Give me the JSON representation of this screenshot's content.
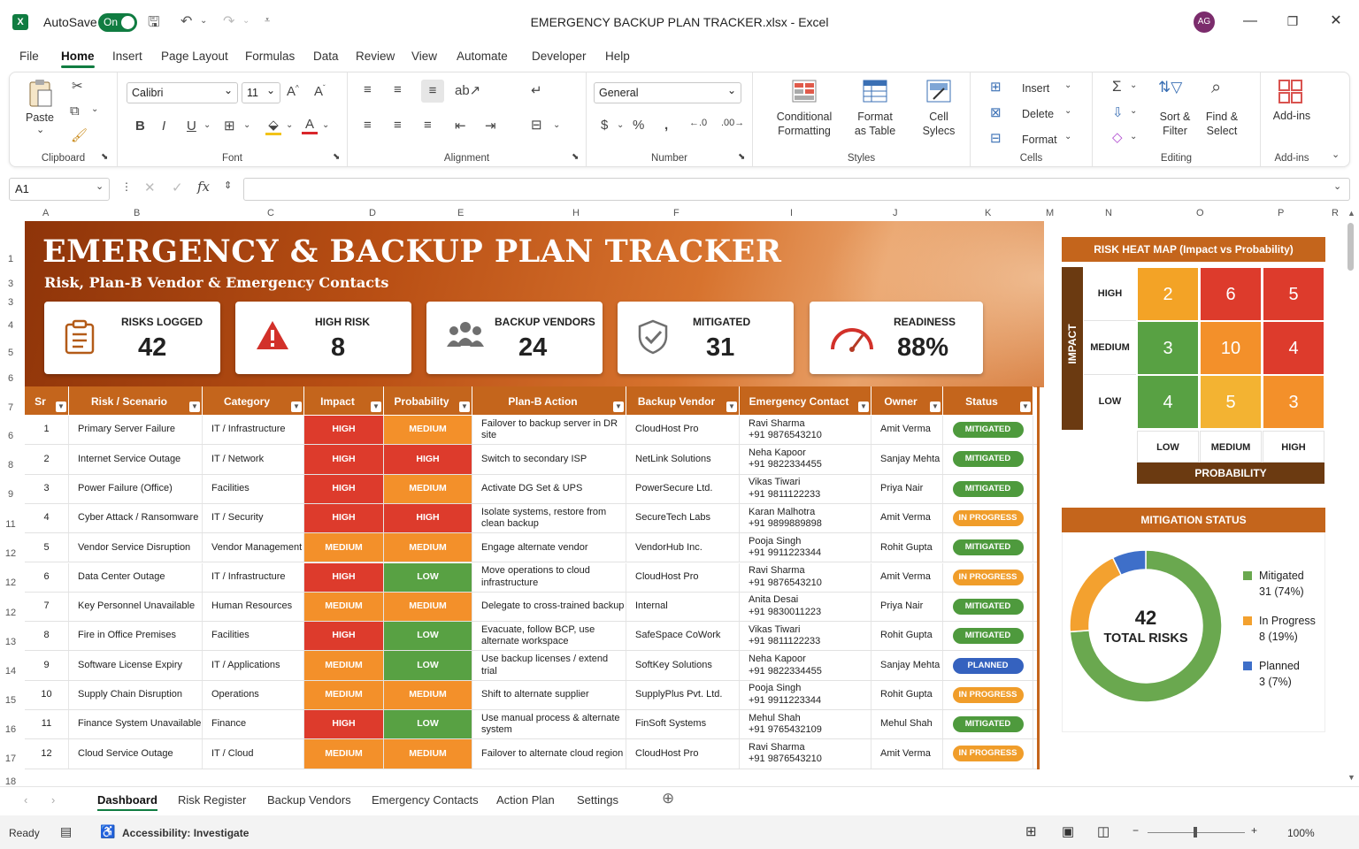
{
  "window": {
    "app_icon": "X",
    "autosave_label": "AutoSave",
    "autosave_state": "On",
    "doc_title": "EMERGENCY BACKUP PLAN TRACKER.xlsx  -  Excel",
    "avatar": "AG"
  },
  "menu": [
    "File",
    "Home",
    "Insert",
    "Page Layout",
    "Formulas",
    "Data",
    "Review",
    "View",
    "Automate",
    "Developer",
    "Help"
  ],
  "ribbon": {
    "clipboard": {
      "paste": "Paste",
      "label": "Clipboard"
    },
    "font": {
      "name": "Calibri",
      "size": "11",
      "label": "Font"
    },
    "alignment": {
      "label": "Alignment"
    },
    "number": {
      "format": "General",
      "label": "Number"
    },
    "styles": {
      "conditional": "Conditional Formatting",
      "format_table": "Format as Table",
      "cell_styles": "Cell Sylecs",
      "label": "Styles"
    },
    "cells": {
      "insert": "Insert",
      "delete": "Delete",
      "format": "Format",
      "label": "Cells"
    },
    "editing": {
      "sort": "Sort & Filter",
      "find": "Find & Select",
      "label": "Editing"
    },
    "addins": {
      "btn": "Add-ins",
      "label": "Add-ins"
    }
  },
  "formula_bar": {
    "name_box": "A1",
    "formula": ""
  },
  "columns": [
    "A",
    "B",
    "C",
    "D",
    "E",
    "H",
    "F",
    "I",
    "J",
    "K",
    "M",
    "N",
    "O",
    "P",
    "R"
  ],
  "rows": [
    "1",
    "3",
    "3",
    "4",
    "5",
    "6",
    "7",
    "6",
    "8",
    "9",
    "11",
    "12",
    "12",
    "12",
    "13",
    "14",
    "15",
    "16",
    "17",
    "18"
  ],
  "dashboard": {
    "title": "EMERGENCY & BACKUP PLAN TRACKER",
    "subtitle": "Risk, Plan-B Vendor & Emergency Contacts",
    "kpis": [
      {
        "label": "RISKS LOGGED",
        "value": "42",
        "icon": "clipboard-icon"
      },
      {
        "label": "HIGH RISK",
        "value": "8",
        "icon": "warning-icon"
      },
      {
        "label": "BACKUP VENDORS",
        "value": "24",
        "icon": "people-icon"
      },
      {
        "label": "MITIGATED",
        "value": "31",
        "icon": "shield-check-icon"
      },
      {
        "label": "READINESS",
        "value": "88%",
        "icon": "gauge-icon"
      }
    ]
  },
  "table": {
    "headers": [
      "Sr",
      "Risk / Scenario",
      "Category",
      "Impact",
      "Probability",
      "Plan-B Action",
      "Backup Vendor",
      "Emergency Contact",
      "Owner",
      "Status"
    ],
    "rows": [
      {
        "sr": "1",
        "risk": "Primary Server Failure",
        "category": "IT / Infrastructure",
        "impact": "HIGH",
        "probability": "MEDIUM",
        "action": "Failover to backup server in DR site",
        "vendor": "CloudHost Pro",
        "contact": "Ravi Sharma\n+91 9876543210",
        "owner": "Amit Verma",
        "status": "MITIGATED"
      },
      {
        "sr": "2",
        "risk": "Internet Service Outage",
        "category": "IT / Network",
        "impact": "HIGH",
        "probability": "HIGH",
        "action": "Switch to secondary ISP",
        "vendor": "NetLink Solutions",
        "contact": "Neha Kapoor\n+91 9822334455",
        "owner": "Sanjay Mehta",
        "status": "MITIGATED"
      },
      {
        "sr": "3",
        "risk": "Power Failure (Office)",
        "category": "Facilities",
        "impact": "HIGH",
        "probability": "MEDIUM",
        "action": "Activate DG Set & UPS",
        "vendor": "PowerSecure Ltd.",
        "contact": "Vikas Tiwari\n+91 9811122233",
        "owner": "Priya Nair",
        "status": "MITIGATED"
      },
      {
        "sr": "4",
        "risk": "Cyber Attack / Ransomware",
        "category": "IT / Security",
        "impact": "HIGH",
        "probability": "HIGH",
        "action": "Isolate systems, restore from clean backup",
        "vendor": "SecureTech Labs",
        "contact": "Karan Malhotra\n+91 9899889898",
        "owner": "Amit Verma",
        "status": "IN PROGRESS"
      },
      {
        "sr": "5",
        "risk": "Vendor Service Disruption",
        "category": "Vendor Management",
        "impact": "MEDIUM",
        "probability": "MEDIUM",
        "action": "Engage alternate vendor",
        "vendor": "VendorHub Inc.",
        "contact": "Pooja Singh\n+91 9911223344",
        "owner": "Rohit Gupta",
        "status": "MITIGATED"
      },
      {
        "sr": "6",
        "risk": "Data Center Outage",
        "category": "IT / Infrastructure",
        "impact": "HIGH",
        "probability": "LOW",
        "action": "Move operations to cloud infrastructure",
        "vendor": "CloudHost Pro",
        "contact": "Ravi Sharma\n+91 9876543210",
        "owner": "Amit Verma",
        "status": "IN PROGRESS"
      },
      {
        "sr": "7",
        "risk": "Key Personnel Unavailable",
        "category": "Human Resources",
        "impact": "MEDIUM",
        "probability": "MEDIUM",
        "action": "Delegate to cross-trained backup",
        "vendor": "Internal",
        "contact": "Anita Desai\n+91 9830011223",
        "owner": "Priya Nair",
        "status": "MITIGATED"
      },
      {
        "sr": "8",
        "risk": "Fire in Office Premises",
        "category": "Facilities",
        "impact": "HIGH",
        "probability": "LOW",
        "action": "Evacuate, follow BCP, use alternate workspace",
        "vendor": "SafeSpace CoWork",
        "contact": "Vikas Tiwari\n+91 9811122233",
        "owner": "Rohit Gupta",
        "status": "MITIGATED"
      },
      {
        "sr": "9",
        "risk": "Software License Expiry",
        "category": "IT / Applications",
        "impact": "MEDIUM",
        "probability": "LOW",
        "action": "Use backup licenses / extend trial",
        "vendor": "SoftKey Solutions",
        "contact": "Neha Kapoor\n+91 9822334455",
        "owner": "Sanjay Mehta",
        "status": "PLANNED"
      },
      {
        "sr": "10",
        "risk": "Supply Chain Disruption",
        "category": "Operations",
        "impact": "MEDIUM",
        "probability": "MEDIUM",
        "action": "Shift to alternate supplier",
        "vendor": "SupplyPlus Pvt. Ltd.",
        "contact": "Pooja Singh\n+91 9911223344",
        "owner": "Rohit Gupta",
        "status": "IN PROGRESS"
      },
      {
        "sr": "11",
        "risk": "Finance System Unavailable",
        "category": "Finance",
        "impact": "HIGH",
        "probability": "LOW",
        "action": "Use manual process & alternate system",
        "vendor": "FinSoft Systems",
        "contact": "Mehul Shah\n+91 9765432109",
        "owner": "Mehul Shah",
        "status": "MITIGATED"
      },
      {
        "sr": "12",
        "risk": "Cloud Service Outage",
        "category": "IT / Cloud",
        "impact": "MEDIUM",
        "probability": "MEDIUM",
        "action": "Failover to alternate cloud region",
        "vendor": "CloudHost Pro",
        "contact": "Ravi Sharma\n+91 9876543210",
        "owner": "Amit Verma",
        "status": "IN PROGRESS"
      }
    ]
  },
  "heatmap": {
    "title": "RISK HEAT MAP (Impact vs Probability)",
    "y_axis": "IMPACT",
    "x_axis": "PROBABILITY",
    "row_labels": [
      "HIGH",
      "MEDIUM",
      "LOW"
    ],
    "col_labels": [
      "LOW",
      "MEDIUM",
      "HIGH"
    ],
    "values": [
      [
        2,
        6,
        5
      ],
      [
        3,
        10,
        4
      ],
      [
        4,
        5,
        3
      ]
    ],
    "colors": [
      [
        "#f3a326",
        "#dd3b2c",
        "#dd3b2c"
      ],
      [
        "#58a143",
        "#f3902a",
        "#dd3b2c"
      ],
      [
        "#58a143",
        "#f3b332",
        "#f3902a"
      ]
    ]
  },
  "chart_data": {
    "type": "pie",
    "title": "MITIGATION STATUS",
    "center_value": "42",
    "center_label": "TOTAL RISKS",
    "series": [
      {
        "name": "Mitigated",
        "value": 31,
        "label": "31 (74%)",
        "color": "#6aa84f"
      },
      {
        "name": "In Progress",
        "value": 8,
        "label": "8 (19%)",
        "color": "#f3a12f"
      },
      {
        "name": "Planned",
        "value": 3,
        "label": "3 (7%)",
        "color": "#3e6fc9"
      }
    ]
  },
  "sheet_tabs": [
    "Dashboard",
    "Risk Register",
    "Backup Vendors",
    "Emergency Contacts",
    "Action Plan",
    "Settings"
  ],
  "status_bar": {
    "ready": "Ready",
    "accessibility": "Accessibility: Investigate",
    "zoom": "100%"
  }
}
